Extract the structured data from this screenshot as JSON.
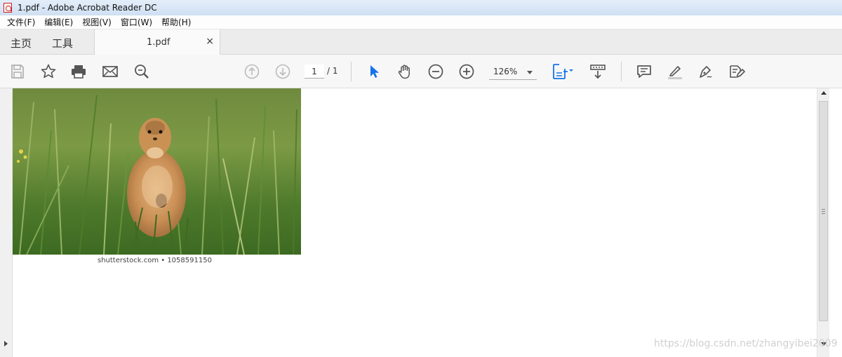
{
  "window": {
    "title": "1.pdf - Adobe Acrobat Reader DC"
  },
  "menu": {
    "items": [
      {
        "label": "文件(F)"
      },
      {
        "label": "编辑(E)"
      },
      {
        "label": "视图(V)"
      },
      {
        "label": "窗口(W)"
      },
      {
        "label": "帮助(H)"
      }
    ]
  },
  "tabs": {
    "home": "主页",
    "tools": "工具",
    "document": "1.pdf",
    "close": "×"
  },
  "toolbar": {
    "icons": [
      "save-icon",
      "bookmark-star-icon",
      "print-icon",
      "email-icon",
      "search-zoom-icon",
      "page-up-icon",
      "page-down-icon",
      "select-cursor-icon",
      "hand-icon",
      "zoom-out-icon",
      "zoom-in-icon",
      "fit-page-icon",
      "scroll-mode-icon",
      "comment-icon",
      "highlight-icon",
      "sign-icon",
      "fill-sign-icon"
    ],
    "current_page": "1",
    "total_pages": "/ 1",
    "zoom": "126%"
  },
  "document": {
    "caption": "shutterstock.com • 1058591150"
  },
  "watermark": "https://blog.csdn.net/zhangyibei2009",
  "colors": {
    "accent": "#1473e6",
    "titlebar": "#d6e4f5",
    "toolbar": "#f7f7f7"
  }
}
